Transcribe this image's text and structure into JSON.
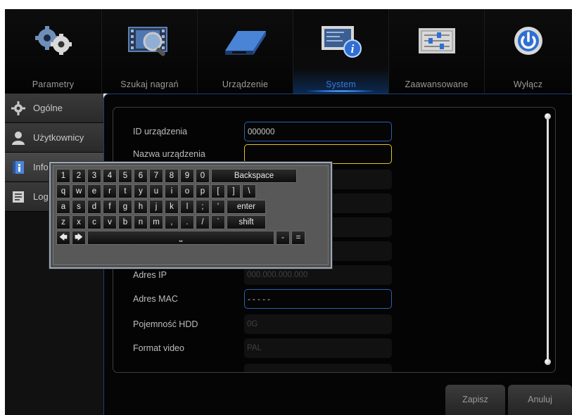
{
  "nav": {
    "tabs": [
      {
        "label": "Parametry",
        "icon": "gears-icon"
      },
      {
        "label": "Szukaj nagrań",
        "icon": "film-search-icon"
      },
      {
        "label": "Urządzenie",
        "icon": "hdd-device-icon"
      },
      {
        "label": "System",
        "icon": "system-info-icon"
      },
      {
        "label": "Zaawansowane",
        "icon": "sliders-icon"
      },
      {
        "label": "Wyłącz",
        "icon": "power-icon"
      }
    ],
    "active": "System"
  },
  "sidebar": {
    "items": [
      {
        "label": "Ogólne",
        "icon": "gear-icon"
      },
      {
        "label": "Użytkownicy",
        "icon": "user-icon"
      },
      {
        "label": "Info",
        "icon": "info-book-icon"
      },
      {
        "label": "Log",
        "icon": "log-icon"
      }
    ]
  },
  "form": {
    "device_id_label": "ID urządzenia",
    "device_id_value": "000000",
    "device_name_label": "Nazwa urządzenia",
    "device_name_value": "",
    "ip_label": "Adres IP",
    "ip_value": "000.000.000.000",
    "mac_label": "Adres MAC",
    "mac_value": "- - - - -",
    "hdd_label": "Pojemność HDD",
    "hdd_value": "0G",
    "video_label": "Format video",
    "video_value": "PAL"
  },
  "keyboard": {
    "row1": [
      "1",
      "2",
      "3",
      "4",
      "5",
      "6",
      "7",
      "8",
      "9",
      "0"
    ],
    "backspace": "Backspace",
    "row2": [
      "q",
      "w",
      "e",
      "r",
      "t",
      "y",
      "u",
      "i",
      "o",
      "p",
      "[",
      "]",
      "\\"
    ],
    "row3": [
      "a",
      "s",
      "d",
      "f",
      "g",
      "h",
      "j",
      "k",
      "l",
      ";",
      "'"
    ],
    "enter": "enter",
    "row4": [
      "z",
      "x",
      "c",
      "v",
      "b",
      "n",
      "m",
      ",",
      ".",
      "/",
      "`"
    ],
    "shift": "shift",
    "left_arrow": "🡄",
    "right_arrow": "🡆",
    "space": "⎵",
    "minus": "-",
    "equals": "="
  },
  "buttons": {
    "save": "Zapisz",
    "cancel": "Anuluj"
  },
  "colors": {
    "accent": "#2b62b0",
    "active_field": "#e3c31d",
    "active_tab_label": "#3a7be0"
  }
}
